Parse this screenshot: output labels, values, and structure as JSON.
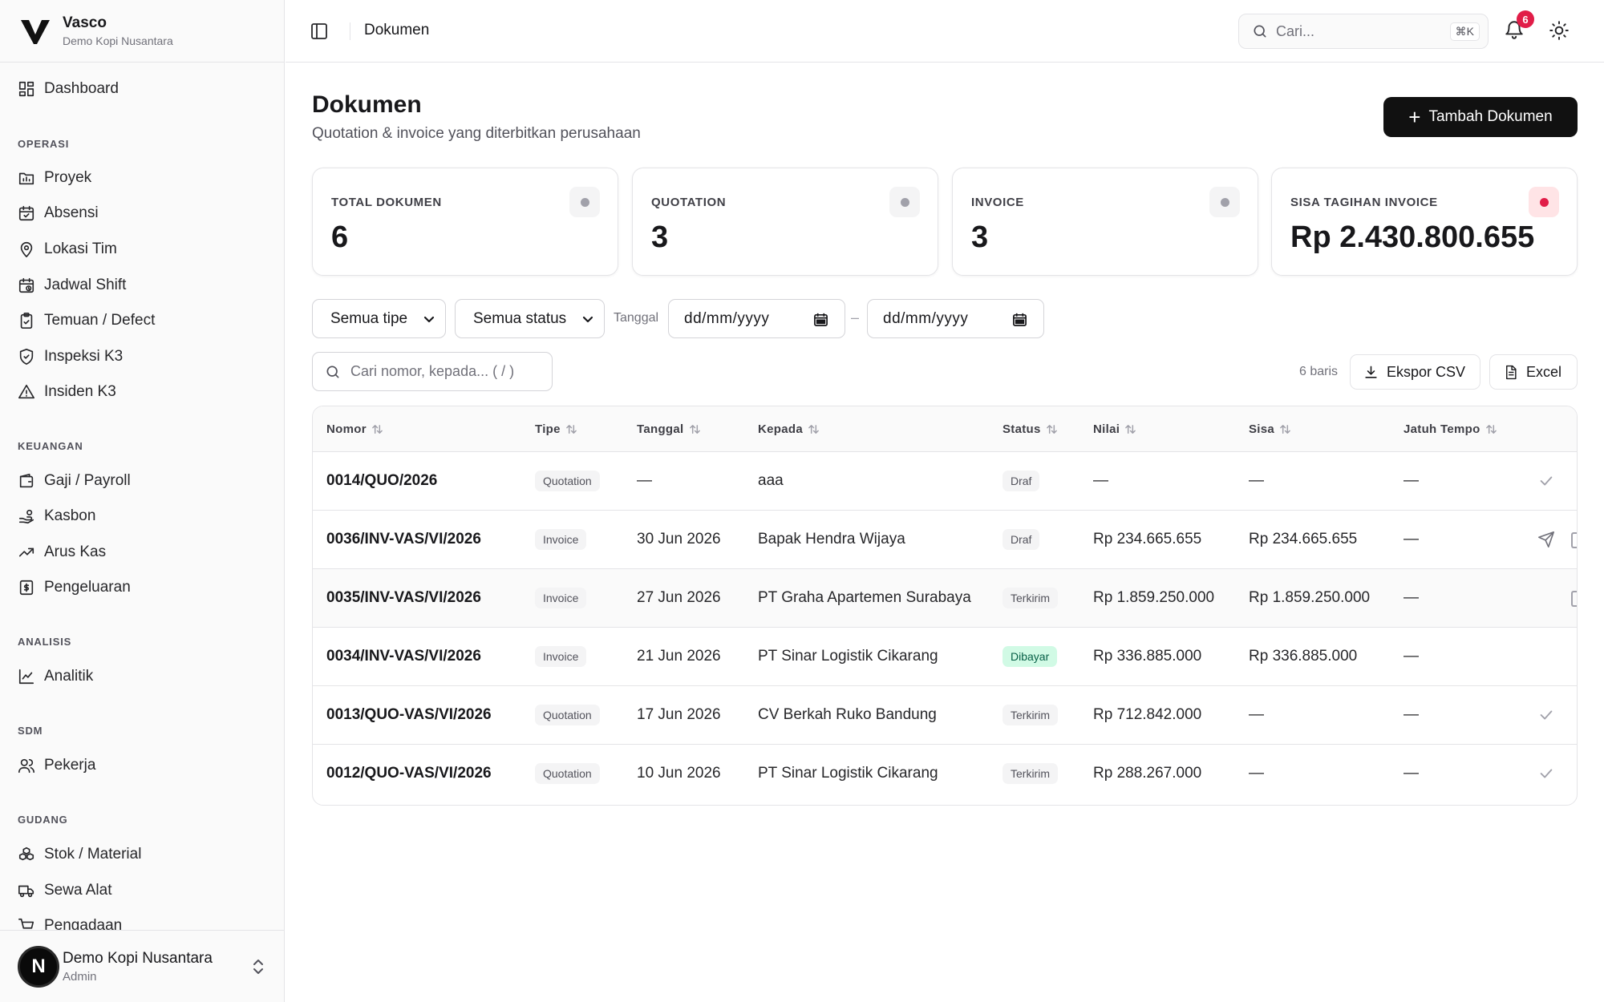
{
  "brand": {
    "name": "Vasco",
    "subtitle": "Demo Kopi Nusantara"
  },
  "sidebar": {
    "dashboard": "Dashboard",
    "sections": {
      "operasi": "OPERASI",
      "keuangan": "KEUANGAN",
      "analisis": "ANALISIS",
      "sdm": "SDM",
      "gudang": "GUDANG"
    },
    "items": {
      "proyek": "Proyek",
      "absensi": "Absensi",
      "lokasi": "Lokasi Tim",
      "jadwal": "Jadwal Shift",
      "temuan": "Temuan / Defect",
      "inspeksi": "Inspeksi K3",
      "insiden": "Insiden K3",
      "gaji": "Gaji / Payroll",
      "kasbon": "Kasbon",
      "arus": "Arus Kas",
      "pengeluaran": "Pengeluaran",
      "analitik": "Analitik",
      "pekerja": "Pekerja",
      "stok": "Stok / Material",
      "sewa": "Sewa Alat",
      "pengadaan": "Pengadaan"
    },
    "footer": {
      "avatar": "N",
      "name": "Demo Kopi Nusantara",
      "role": "Admin"
    }
  },
  "topbar": {
    "title": "Dokumen",
    "search_placeholder": "Cari...",
    "shortcut": "⌘K",
    "notif_count": "6"
  },
  "page": {
    "title": "Dokumen",
    "subtitle": "Quotation & invoice yang diterbitkan perusahaan",
    "add_button": "Tambah Dokumen"
  },
  "stats": [
    {
      "label": "TOTAL DOKUMEN",
      "value": "6"
    },
    {
      "label": "QUOTATION",
      "value": "3"
    },
    {
      "label": "INVOICE",
      "value": "3"
    },
    {
      "label": "SISA TAGIHAN INVOICE",
      "value": "Rp 2.430.800.655"
    }
  ],
  "filters": {
    "type": "Semua tipe",
    "status": "Semua status",
    "date_label": "Tanggal",
    "date_from": "dd/mm/yyyy",
    "date_sep": "–",
    "date_to": "dd/mm/yyyy",
    "search_placeholder": "Cari nomor, kepada...  ( / )",
    "row_count": "6 baris",
    "export_csv": "Ekspor CSV",
    "excel": "Excel"
  },
  "table": {
    "headers": {
      "nomor": "Nomor",
      "tipe": "Tipe",
      "tanggal": "Tanggal",
      "kepada": "Kepada",
      "status": "Status",
      "nilai": "Nilai",
      "sisa": "Sisa",
      "jatuh_tempo": "Jatuh Tempo"
    },
    "rows": [
      {
        "nomor": "0014/QUO/2026",
        "tipe": "Quotation",
        "tanggal": "—",
        "kepada": "aaa",
        "status": "Draf",
        "nilai": "—",
        "sisa": "—",
        "jatuh_tempo": "—"
      },
      {
        "nomor": "0036/INV-VAS/VI/2026",
        "tipe": "Invoice",
        "tanggal": "30 Jun 2026",
        "kepada": "Bapak Hendra Wijaya",
        "status": "Draf",
        "nilai": "Rp 234.665.655",
        "sisa": "Rp 234.665.655",
        "jatuh_tempo": "—"
      },
      {
        "nomor": "0035/INV-VAS/VI/2026",
        "tipe": "Invoice",
        "tanggal": "27 Jun 2026",
        "kepada": "PT Graha Apartemen Surabaya",
        "status": "Terkirim",
        "nilai": "Rp 1.859.250.000",
        "sisa": "Rp 1.859.250.000",
        "jatuh_tempo": "—"
      },
      {
        "nomor": "0034/INV-VAS/VI/2026",
        "tipe": "Invoice",
        "tanggal": "21 Jun 2026",
        "kepada": "PT Sinar Logistik Cikarang",
        "status": "Dibayar",
        "nilai": "Rp 336.885.000",
        "sisa": "Rp 336.885.000",
        "jatuh_tempo": "—"
      },
      {
        "nomor": "0013/QUO-VAS/VI/2026",
        "tipe": "Quotation",
        "tanggal": "17 Jun 2026",
        "kepada": "CV Berkah Ruko Bandung",
        "status": "Terkirim",
        "nilai": "Rp 712.842.000",
        "sisa": "—",
        "jatuh_tempo": "—"
      },
      {
        "nomor": "0012/QUO-VAS/VI/2026",
        "tipe": "Quotation",
        "tanggal": "10 Jun 2026",
        "kepada": "PT Sinar Logistik Cikarang",
        "status": "Terkirim",
        "nilai": "Rp 288.267.000",
        "sisa": "—",
        "jatuh_tempo": "—"
      }
    ]
  },
  "colors": {
    "accent": "#111111",
    "danger": "#e11d48",
    "paid_bg": "#d1fae5",
    "paid_text": "#065f46"
  }
}
